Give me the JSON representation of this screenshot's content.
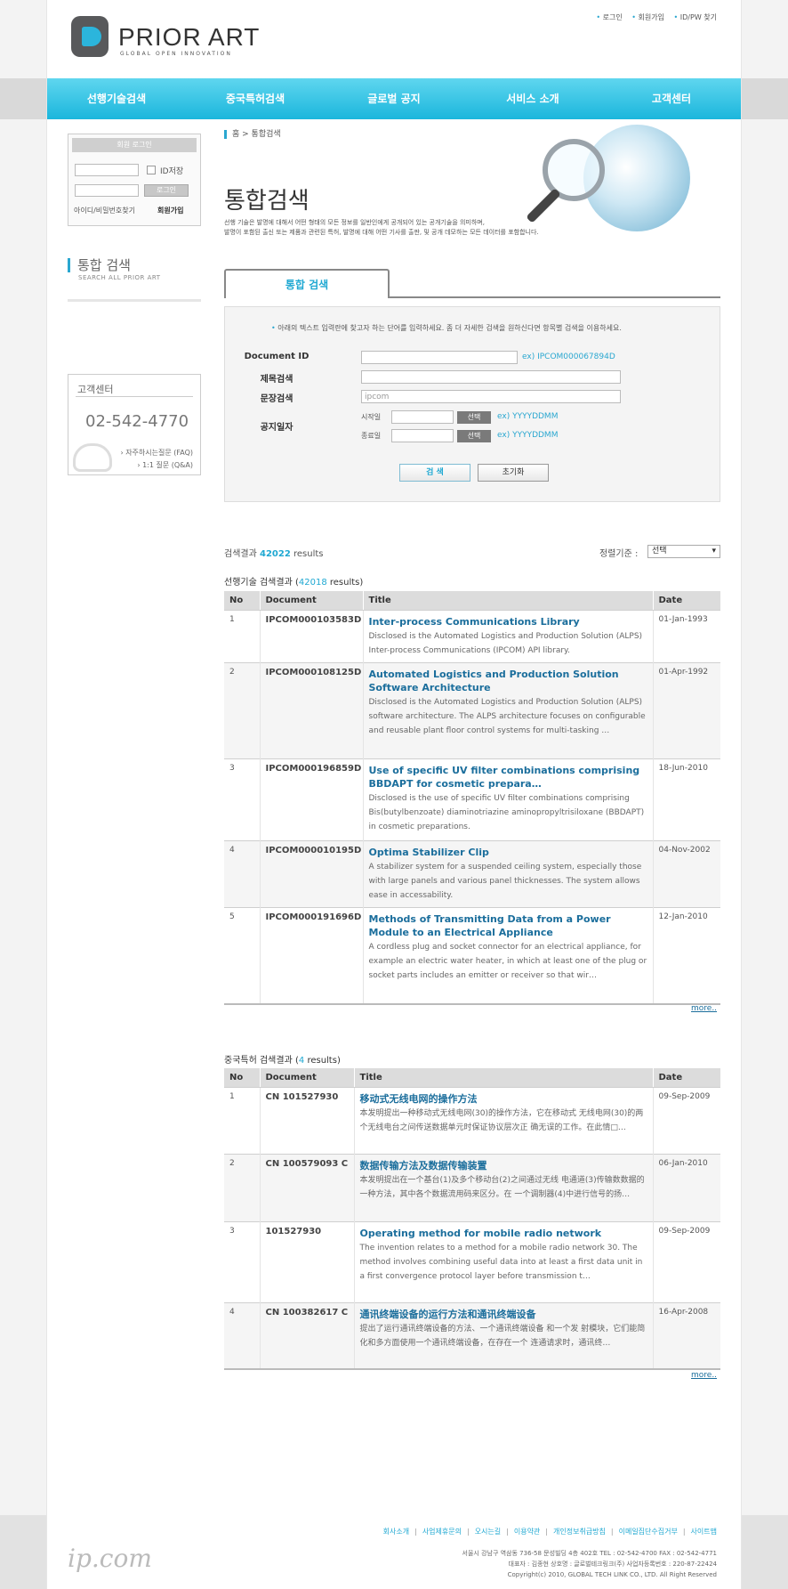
{
  "header": {
    "logo_title": "PRIOR ART",
    "logo_sub": "GLOBAL OPEN INNOVATION",
    "util_links": [
      "로그인",
      "회원가입",
      "ID/PW 찾기"
    ]
  },
  "nav": [
    "선행기술검색",
    "중국특허검색",
    "글로벌 공지",
    "서비스 소개",
    "고객센터"
  ],
  "login": {
    "title": "회원 로그인",
    "save_id": "ID저장",
    "button": "로그인",
    "find": "아이디/비밀번호찾기",
    "join": "회원가입"
  },
  "side": {
    "title": "통합 검색",
    "subtitle": "SEARCH ALL PRIOR ART"
  },
  "cs": {
    "title": "고객센터",
    "tel": "02-542-4770",
    "faq": "자주하시는질문 (FAQ)",
    "qna": "1:1 질문 (Q&A)"
  },
  "breadcrumb": {
    "home": "홈",
    "current": "통합검색"
  },
  "page": {
    "title": "통합검색",
    "desc1": "선행 기술은 발명에 대해서 어떤 형태의 모든 정보를 일반인에게 공개되어 있는 공개기술을 의미하며,",
    "desc2": "발명이 포함된 출신 또는 제품과 관련된 특허, 발명에 대해 어떤 기사를 출판, 및 공개 데모하는 모든 데이터를 포함합니다."
  },
  "search": {
    "tab": "통합 검색",
    "notice": "아래의 텍스트 입력란에 찾고자 하는 단어를 입력하세요. 좀 더 자세한 검색을 원하신다면 항목별 검색을 이용하세요.",
    "doc_id_label": "Document ID",
    "doc_id_example": "ex) IPCOM000067894D",
    "title_label": "제목검색",
    "text_label": "문장검색",
    "text_value": "ipcom",
    "date_label": "공지일자",
    "start_label": "시작일",
    "end_label": "종료일",
    "select_btn": "선택",
    "date_example": "ex) YYYYDDMM",
    "search_btn": "검 색",
    "reset_btn": "초기화"
  },
  "results": {
    "summary_prefix": "검색결과",
    "total": "42022",
    "summary_suffix": "results",
    "sort_label": "정렬기준 :",
    "sort_value": "선택"
  },
  "prior_art": {
    "title": "선행기술 검색결과",
    "count": "42018",
    "count_suffix": "results)",
    "columns": [
      "No",
      "Document",
      "Title",
      "Date"
    ],
    "rows": [
      {
        "no": "1",
        "doc": "IPCOM000103583D",
        "title": "Inter-process Communications Library",
        "abstract": "Disclosed is the Automated Logistics and Production Solution (ALPS) Inter-process Communications (IPCOM) API library.",
        "date": "01-Jan-1993"
      },
      {
        "no": "2",
        "doc": "IPCOM000108125D",
        "title": "Automated Logistics and Production Solution Software Architecture",
        "abstract": "Disclosed is the Automated Logistics and Production Solution (ALPS) software architecture. The ALPS architecture focuses on configurable and reusable plant floor control systems for multi-tasking …",
        "date": "01-Apr-1992"
      },
      {
        "no": "3",
        "doc": "IPCOM000196859D",
        "title": "Use of specific UV filter combinations comprising BBDAPT for cosmetic prepara…",
        "abstract": "Disclosed is the use of specific UV filter combinations comprising Bis(butylbenzoate) diaminotriazine aminopropyltrisiloxane (BBDAPT) in cosmetic preparations.",
        "date": "18-Jun-2010"
      },
      {
        "no": "4",
        "doc": "IPCOM000010195D",
        "title": "Optima Stabilizer Clip",
        "abstract": "A stabilizer system for a suspended ceiling system, especially those with large panels and various panel thicknesses. The system allows ease in accessability.",
        "date": "04-Nov-2002"
      },
      {
        "no": "5",
        "doc": "IPCOM000191696D",
        "title": "Methods of Transmitting Data from a Power Module to an Electrical Appliance",
        "abstract": "A cordless plug and socket connector for an electrical appliance, for example an electric water heater, in which at least one of the plug or socket parts includes an emitter or receiver so that wir…",
        "date": "12-Jan-2010"
      }
    ],
    "more": "more.."
  },
  "china": {
    "title": "중국특허 검색결과",
    "count": "4",
    "count_suffix": "results)",
    "columns": [
      "No",
      "Document",
      "Title",
      "Date"
    ],
    "rows": [
      {
        "no": "1",
        "doc": "CN 101527930",
        "title": "移动式无线电网的操作方法",
        "abstract": "本发明提出一种移动式无线电网(30)的操作方法，它在移动式 无线电网(30)的两个无线电台之间传送数据单元时保证协议层次正 确无误的工作。在此情□…",
        "date": "09-Sep-2009"
      },
      {
        "no": "2",
        "doc": "CN 100579093 C",
        "title": "数据传输方法及数据传输装置",
        "abstract": "本发明提出在一个基台(1)及多个移动台(2)之间通过无线 电通道(3)传输数数据的一种方法，其中各个数据流用码来区分。在 一个调制器(4)中进行信号的扬…",
        "date": "06-Jan-2010"
      },
      {
        "no": "3",
        "doc": "101527930",
        "title": "Operating method for mobile radio network",
        "abstract": "The invention relates to a method for a mobile radio network 30. The method involves combining useful data into at least a first data unit in a first convergence protocol layer before transmission t…",
        "date": "09-Sep-2009"
      },
      {
        "no": "4",
        "doc": "CN 100382617 C",
        "title": "通讯终端设备的运行方法和通讯终端设备",
        "abstract": "提出了运行通讯终端设备的方法、一个通讯终端设备 和一个发 射模块，它们能简化和多方面使用一个通讯终端设备，在存在一个 连通请求时，通讯终…",
        "date": "16-Apr-2008"
      }
    ],
    "more": "more.."
  },
  "footer": {
    "links": [
      "회사소개",
      "사업제휴문의",
      "오시는길",
      "이용약관",
      "개인정보취급방침",
      "이메일집단수집거부",
      "사이트맵"
    ],
    "addr1": "서울시 강남구 역삼동 736-58 문성빌딩 4층 402호   TEL : 02-542-4700   FAX : 02-542-4771",
    "addr2": "대표자 : 김종현   상호명 : 글로벌테크링크(주)   사업자등록번호 : 220-87-22424",
    "copyright": "Copyright(c) 2010, GLOBAL TECH LINK CO., LTD. All Right Reserved",
    "logo": "ip.com"
  }
}
